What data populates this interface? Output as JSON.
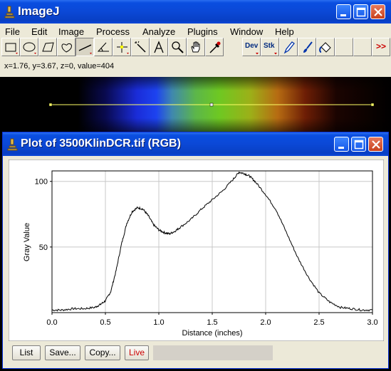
{
  "main_window": {
    "title": "ImageJ",
    "menu": [
      "File",
      "Edit",
      "Image",
      "Process",
      "Analyze",
      "Plugins",
      "Window",
      "Help"
    ],
    "tools": [
      {
        "name": "rectangle-tool-icon"
      },
      {
        "name": "oval-tool-icon"
      },
      {
        "name": "polygon-tool-icon"
      },
      {
        "name": "freehand-tool-icon"
      },
      {
        "name": "straight-line-tool-icon",
        "active": true
      },
      {
        "name": "angle-tool-icon"
      },
      {
        "name": "point-tool-icon"
      },
      {
        "name": "wand-tool-icon"
      },
      {
        "name": "text-tool-icon"
      },
      {
        "name": "magnifier-tool-icon"
      },
      {
        "name": "hand-tool-icon"
      },
      {
        "name": "dropper-tool-icon"
      },
      {
        "name": "dev-menu-tool"
      },
      {
        "name": "stk-menu-tool"
      },
      {
        "name": "pencil-tool-icon"
      },
      {
        "name": "brush-tool-icon"
      },
      {
        "name": "flood-fill-tool-icon"
      },
      {
        "name": "empty-slot"
      },
      {
        "name": "more-tools-icon"
      }
    ],
    "dev_label": "Dev",
    "stk_label": "Stk",
    "more_label": ">>",
    "status": "x=1.76, y=3.67, z=0, value=404"
  },
  "plot_window": {
    "title": "Plot of 3500KlinDCR.tif (RGB)",
    "buttons": {
      "list": "List",
      "save": "Save...",
      "copy": "Copy...",
      "live": "Live"
    },
    "live_color": "#cc0000"
  },
  "chart_data": {
    "type": "line",
    "xlabel": "Distance (inches)",
    "ylabel": "Gray Value",
    "xlim": [
      0,
      3.0
    ],
    "ylim": [
      0,
      108
    ],
    "xticks": [
      "0.0",
      "0.5",
      "1.0",
      "1.5",
      "2.0",
      "2.5",
      "3.0"
    ],
    "yticks": [
      "50",
      "100"
    ],
    "grid": true,
    "series": [
      {
        "x": [
          0,
          0.1,
          0.2,
          0.3,
          0.4,
          0.45,
          0.5,
          0.55,
          0.6,
          0.65,
          0.7,
          0.75,
          0.8,
          0.85,
          0.9,
          0.95,
          1.0,
          1.05,
          1.1,
          1.15,
          1.2,
          1.3,
          1.4,
          1.5,
          1.6,
          1.7,
          1.75,
          1.8,
          1.85,
          1.9,
          2.0,
          2.1,
          2.2,
          2.3,
          2.4,
          2.5,
          2.6,
          2.7,
          2.8,
          2.9,
          3.0
        ],
        "y": [
          2,
          2,
          3,
          3,
          4,
          6,
          9,
          16,
          32,
          52,
          68,
          77,
          80,
          79,
          74,
          67,
          63,
          61,
          60,
          62,
          65,
          71,
          79,
          86,
          93,
          102,
          107,
          106,
          104,
          100,
          90,
          78,
          60,
          42,
          27,
          15,
          8,
          4,
          3,
          2,
          2
        ]
      }
    ]
  }
}
